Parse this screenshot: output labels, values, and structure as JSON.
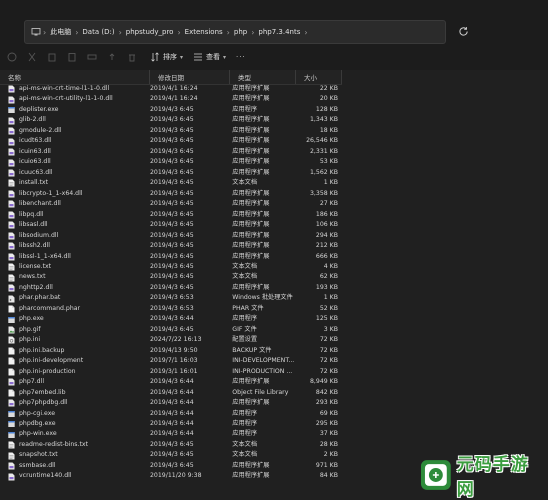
{
  "breadcrumb": [
    "此电脑",
    "Data (D:)",
    "phpstudy_pro",
    "Extensions",
    "php",
    "php7.3.4nts"
  ],
  "toolbar": {
    "sort_label": "排序",
    "view_label": "查看"
  },
  "columns": {
    "name": "名称",
    "date": "修改日期",
    "type": "类型",
    "size": "大小"
  },
  "files": [
    {
      "name": "api-ms-win-crt-time-l1-1-0.dll",
      "date": "2019/4/1 16:24",
      "type": "应用程序扩展",
      "size": "22 KB",
      "icon": "dll"
    },
    {
      "name": "api-ms-win-crt-utility-l1-1-0.dll",
      "date": "2019/4/1 16:24",
      "type": "应用程序扩展",
      "size": "20 KB",
      "icon": "dll"
    },
    {
      "name": "deplister.exe",
      "date": "2019/4/3 6:45",
      "type": "应用程序",
      "size": "128 KB",
      "icon": "exe"
    },
    {
      "name": "glib-2.dll",
      "date": "2019/4/3 6:45",
      "type": "应用程序扩展",
      "size": "1,343 KB",
      "icon": "dll"
    },
    {
      "name": "gmodule-2.dll",
      "date": "2019/4/3 6:45",
      "type": "应用程序扩展",
      "size": "18 KB",
      "icon": "dll"
    },
    {
      "name": "icudt63.dll",
      "date": "2019/4/3 6:45",
      "type": "应用程序扩展",
      "size": "26,546 KB",
      "icon": "dll"
    },
    {
      "name": "icuin63.dll",
      "date": "2019/4/3 6:45",
      "type": "应用程序扩展",
      "size": "2,331 KB",
      "icon": "dll"
    },
    {
      "name": "icuio63.dll",
      "date": "2019/4/3 6:45",
      "type": "应用程序扩展",
      "size": "53 KB",
      "icon": "dll"
    },
    {
      "name": "icuuc63.dll",
      "date": "2019/4/3 6:45",
      "type": "应用程序扩展",
      "size": "1,562 KB",
      "icon": "dll"
    },
    {
      "name": "install.txt",
      "date": "2019/4/3 6:45",
      "type": "文本文档",
      "size": "1 KB",
      "icon": "txt"
    },
    {
      "name": "libcrypto-1_1-x64.dll",
      "date": "2019/4/3 6:45",
      "type": "应用程序扩展",
      "size": "3,358 KB",
      "icon": "dll"
    },
    {
      "name": "libenchant.dll",
      "date": "2019/4/3 6:45",
      "type": "应用程序扩展",
      "size": "27 KB",
      "icon": "dll"
    },
    {
      "name": "libpq.dll",
      "date": "2019/4/3 6:45",
      "type": "应用程序扩展",
      "size": "186 KB",
      "icon": "dll"
    },
    {
      "name": "libsasl.dll",
      "date": "2019/4/3 6:45",
      "type": "应用程序扩展",
      "size": "106 KB",
      "icon": "dll"
    },
    {
      "name": "libsodium.dll",
      "date": "2019/4/3 6:45",
      "type": "应用程序扩展",
      "size": "294 KB",
      "icon": "dll"
    },
    {
      "name": "libssh2.dll",
      "date": "2019/4/3 6:45",
      "type": "应用程序扩展",
      "size": "212 KB",
      "icon": "dll"
    },
    {
      "name": "libssl-1_1-x64.dll",
      "date": "2019/4/3 6:45",
      "type": "应用程序扩展",
      "size": "666 KB",
      "icon": "dll"
    },
    {
      "name": "license.txt",
      "date": "2019/4/3 6:45",
      "type": "文本文档",
      "size": "4 KB",
      "icon": "txt"
    },
    {
      "name": "news.txt",
      "date": "2019/4/3 6:45",
      "type": "文本文档",
      "size": "62 KB",
      "icon": "txt"
    },
    {
      "name": "nghttp2.dll",
      "date": "2019/4/3 6:45",
      "type": "应用程序扩展",
      "size": "193 KB",
      "icon": "dll"
    },
    {
      "name": "phar.phar.bat",
      "date": "2019/4/3 6:53",
      "type": "Windows 批处理文件",
      "size": "1 KB",
      "icon": "bat"
    },
    {
      "name": "pharcommand.phar",
      "date": "2019/4/3 6:53",
      "type": "PHAR 文件",
      "size": "52 KB",
      "icon": "file"
    },
    {
      "name": "php.exe",
      "date": "2019/4/3 6:44",
      "type": "应用程序",
      "size": "125 KB",
      "icon": "exe"
    },
    {
      "name": "php.gif",
      "date": "2019/4/3 6:45",
      "type": "GIF 文件",
      "size": "3 KB",
      "icon": "gif"
    },
    {
      "name": "php.ini",
      "date": "2024/7/22 16:13",
      "type": "配置设置",
      "size": "72 KB",
      "icon": "ini"
    },
    {
      "name": "php.ini.backup",
      "date": "2019/4/13 9:50",
      "type": "BACKUP 文件",
      "size": "72 KB",
      "icon": "file"
    },
    {
      "name": "php.ini-development",
      "date": "2019/7/1 16:03",
      "type": "INI-DEVELOPMENT...",
      "size": "72 KB",
      "icon": "file"
    },
    {
      "name": "php.ini-production",
      "date": "2019/3/1 16:01",
      "type": "INI-PRODUCTION ...",
      "size": "72 KB",
      "icon": "file"
    },
    {
      "name": "php7.dll",
      "date": "2019/4/3 6:44",
      "type": "应用程序扩展",
      "size": "8,949 KB",
      "icon": "dll"
    },
    {
      "name": "php7embed.lib",
      "date": "2019/4/3 6:44",
      "type": "Object File Library",
      "size": "842 KB",
      "icon": "file"
    },
    {
      "name": "php7phpdbg.dll",
      "date": "2019/4/3 6:44",
      "type": "应用程序扩展",
      "size": "293 KB",
      "icon": "dll"
    },
    {
      "name": "php-cgi.exe",
      "date": "2019/4/3 6:44",
      "type": "应用程序",
      "size": "69 KB",
      "icon": "exe"
    },
    {
      "name": "phpdbg.exe",
      "date": "2019/4/3 6:44",
      "type": "应用程序",
      "size": "295 KB",
      "icon": "exe"
    },
    {
      "name": "php-win.exe",
      "date": "2019/4/3 6:44",
      "type": "应用程序",
      "size": "37 KB",
      "icon": "exe"
    },
    {
      "name": "readme-redist-bins.txt",
      "date": "2019/4/3 6:45",
      "type": "文本文档",
      "size": "28 KB",
      "icon": "txt"
    },
    {
      "name": "snapshot.txt",
      "date": "2019/4/3 6:45",
      "type": "文本文档",
      "size": "2 KB",
      "icon": "txt"
    },
    {
      "name": "ssmbase.dll",
      "date": "2019/4/3 6:45",
      "type": "应用程序扩展",
      "size": "971 KB",
      "icon": "dll"
    },
    {
      "name": "vcruntime140.dll",
      "date": "2019/11/20 9:38",
      "type": "应用程序扩展",
      "size": "84 KB",
      "icon": "dll"
    }
  ],
  "watermark": {
    "text": "元码手游网"
  }
}
